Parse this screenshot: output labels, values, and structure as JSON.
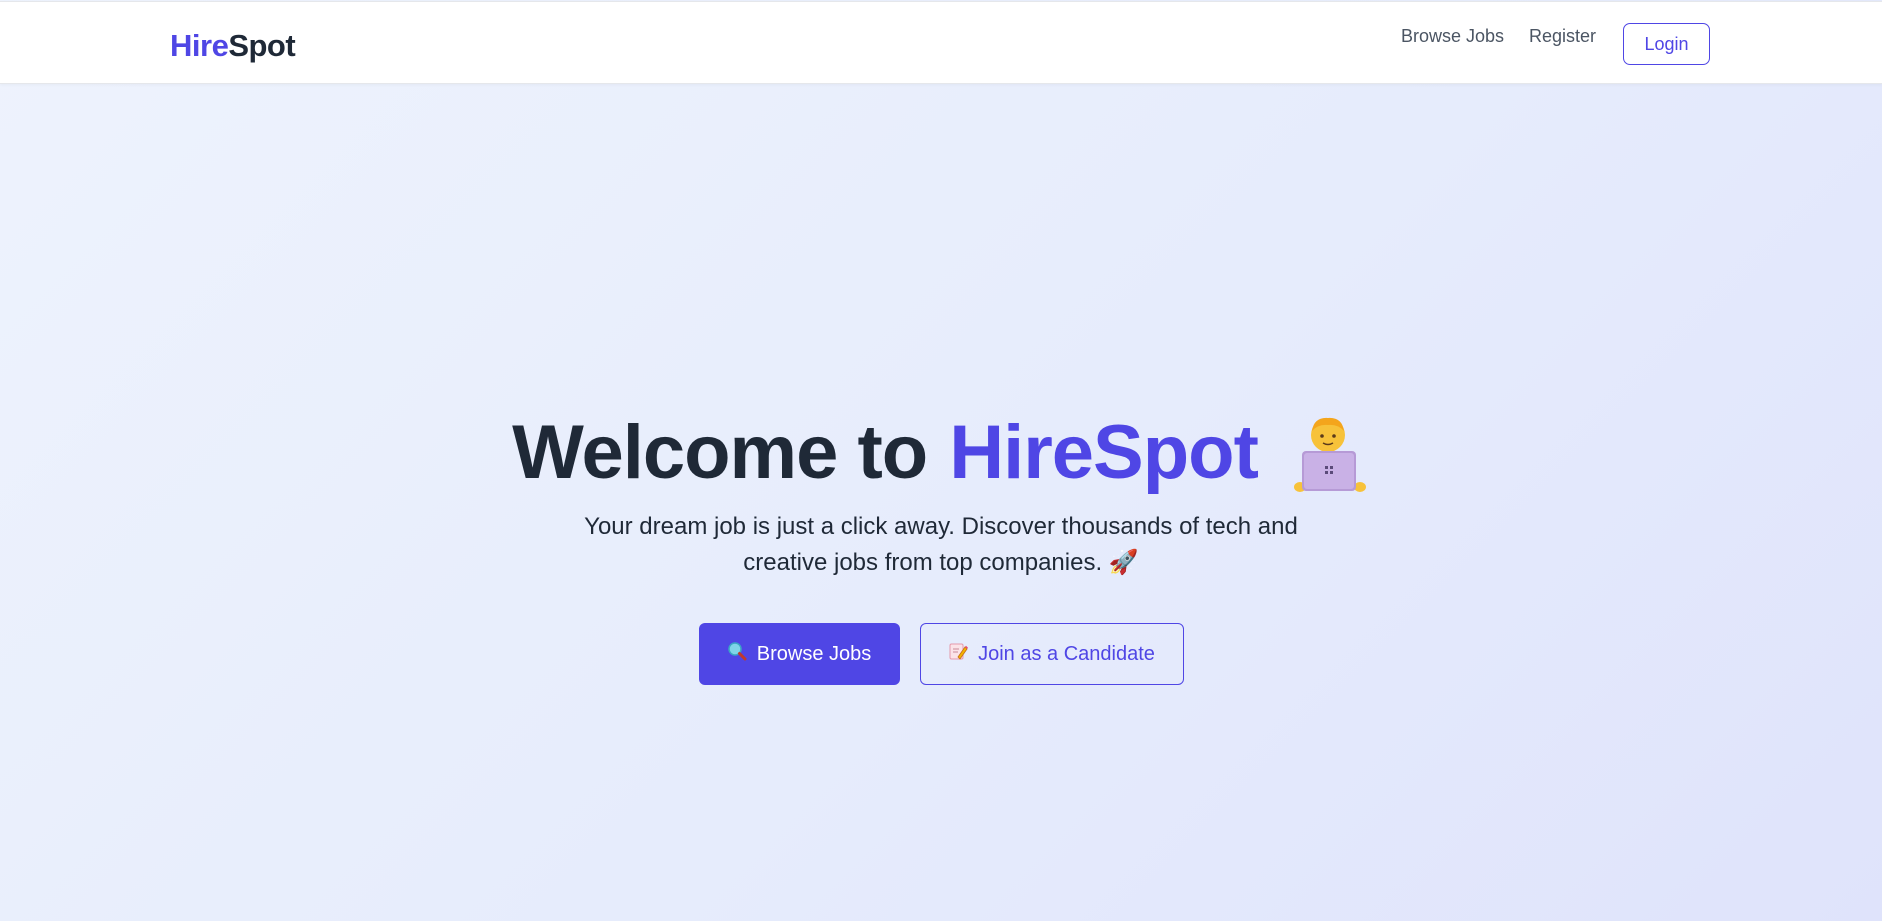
{
  "nav": {
    "brand_part1": "Hire",
    "brand_part2": "Spot",
    "links": [
      {
        "label": "Browse Jobs"
      },
      {
        "label": "Register"
      }
    ],
    "login_label": "Login"
  },
  "hero": {
    "title_prefix": "Welcome to",
    "title_accent": "HireSpot",
    "title_icon": "person-with-laptop-icon",
    "subtitle": "Your dream job is just a click away. Discover thousands of tech and creative jobs from top companies. 🚀",
    "primary_button": {
      "icon": "magnifier-icon",
      "label": "Browse Jobs"
    },
    "secondary_button": {
      "icon": "memo-icon",
      "label": "Join as a Candidate"
    }
  },
  "colors": {
    "accent": "#4f46e5",
    "text_dark": "#1f2937",
    "nav_text": "#4b5563",
    "background_start": "#eef3fd",
    "background_end": "#dfe3fb"
  }
}
